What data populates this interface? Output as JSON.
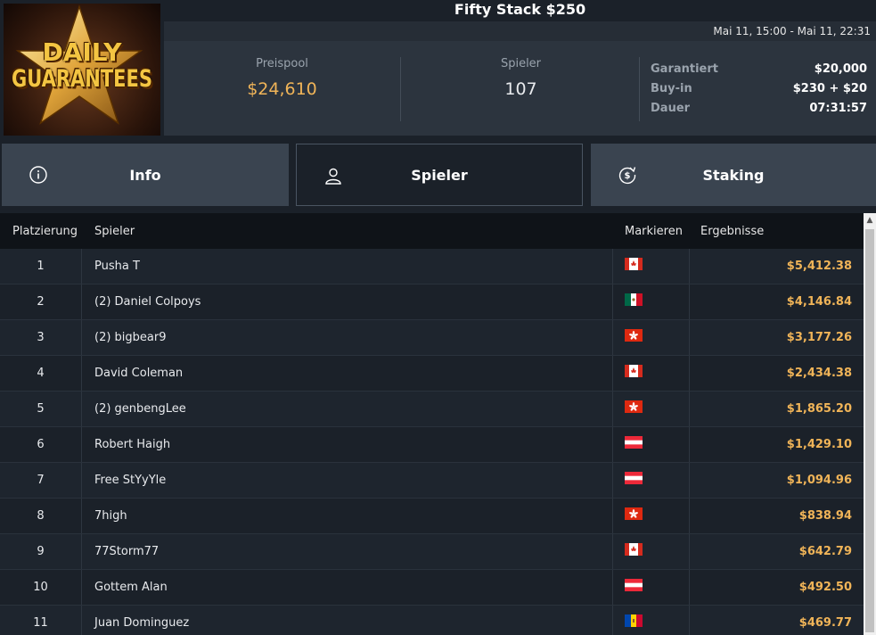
{
  "logo": {
    "line1": "DAILY",
    "line2": "GUARANTEES"
  },
  "header": {
    "title": "Fifty Stack $250",
    "date_range": "Mai 11, 15:00 - Mai 11, 22:31"
  },
  "stats": {
    "pool_label": "Preispool",
    "pool_value": "$24,610",
    "players_label": "Spieler",
    "players_value": "107",
    "details": [
      {
        "key": "Garantiert",
        "value": "$20,000"
      },
      {
        "key": "Buy-in",
        "value": "$230 + $20"
      },
      {
        "key": "Dauer",
        "value": "07:31:57"
      }
    ]
  },
  "tabs": [
    {
      "label": "Info",
      "icon": "info-icon"
    },
    {
      "label": "Spieler",
      "icon": "user-icon",
      "active": true
    },
    {
      "label": "Staking",
      "icon": "dollar-refresh-icon"
    }
  ],
  "table": {
    "headers": {
      "rank": "Platzierung",
      "player": "Spieler",
      "flag": "Markieren",
      "result": "Ergebnisse"
    },
    "rows": [
      {
        "rank": "1",
        "player": "Pusha T",
        "flag": "ca",
        "result": "$5,412.38"
      },
      {
        "rank": "2",
        "player": "(2) Daniel Colpoys",
        "flag": "mx",
        "result": "$4,146.84"
      },
      {
        "rank": "3",
        "player": "(2) bigbear9",
        "flag": "hk",
        "result": "$3,177.26"
      },
      {
        "rank": "4",
        "player": "David Coleman",
        "flag": "ca",
        "result": "$2,434.38"
      },
      {
        "rank": "5",
        "player": "(2) genbengLee",
        "flag": "hk",
        "result": "$1,865.20"
      },
      {
        "rank": "6",
        "player": "Robert Haigh",
        "flag": "at",
        "result": "$1,429.10"
      },
      {
        "rank": "7",
        "player": "Free StYyYle",
        "flag": "at",
        "result": "$1,094.96"
      },
      {
        "rank": "8",
        "player": "7high",
        "flag": "hk",
        "result": "$838.94"
      },
      {
        "rank": "9",
        "player": "77Storm77",
        "flag": "ca",
        "result": "$642.79"
      },
      {
        "rank": "10",
        "player": "Gottem Alan",
        "flag": "at",
        "result": "$492.50"
      },
      {
        "rank": "11",
        "player": "Juan Dominguez",
        "flag": "md",
        "result": "$469.77"
      }
    ]
  },
  "colors": {
    "accent": "#f0b458",
    "bg": "#1b2129",
    "panel": "#2c343e",
    "tab": "#3a4450"
  }
}
